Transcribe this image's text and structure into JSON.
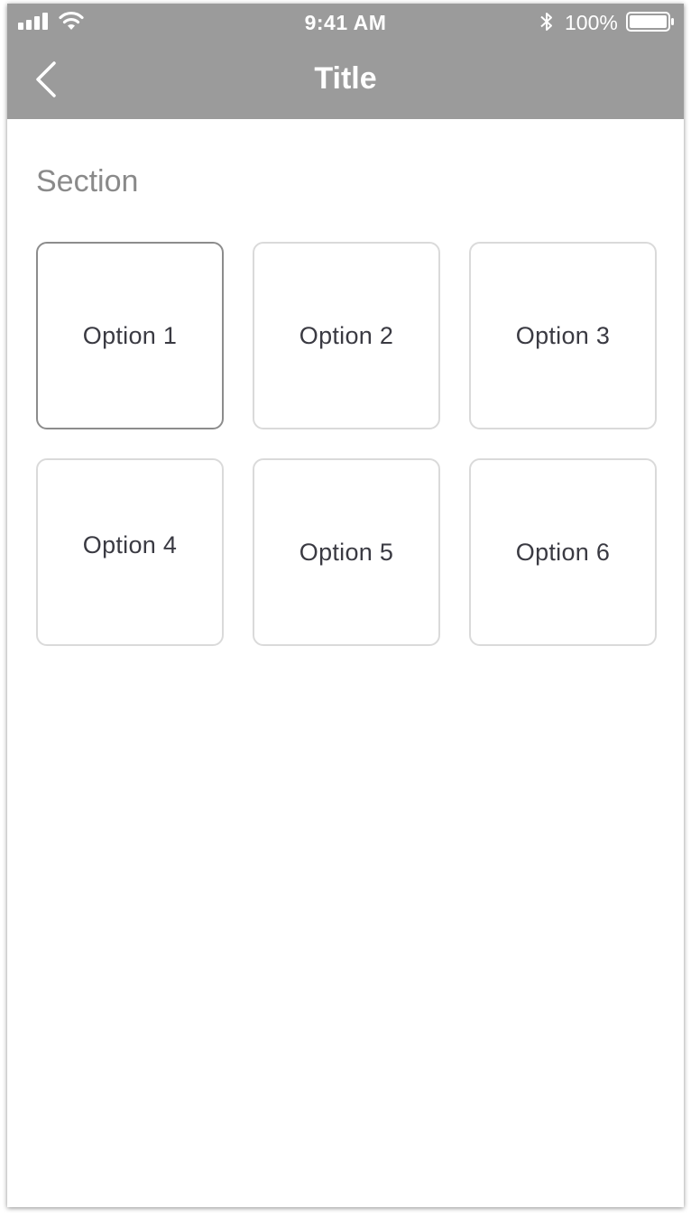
{
  "status_bar": {
    "time": "9:41 AM",
    "battery_percent": "100%",
    "signal_icon": "cellular-signal-icon",
    "wifi_icon": "wifi-icon",
    "bluetooth_icon": "bluetooth-icon",
    "battery_icon": "battery-icon",
    "battery_level": 1.0
  },
  "nav": {
    "title": "Title",
    "back_icon": "chevron-left-icon"
  },
  "colors": {
    "nav_background": "#9b9b9b",
    "selected_border": "#8c8c8c",
    "option_border": "#dadada",
    "section_text": "#8a8a8a"
  },
  "section": {
    "title": "Section"
  },
  "options": [
    {
      "label": "Option 1",
      "selected": true
    },
    {
      "label": "Option 2",
      "selected": false
    },
    {
      "label": "Option 3",
      "selected": false
    },
    {
      "label": "Option 4",
      "selected": false
    },
    {
      "label": "Option 5",
      "selected": false
    },
    {
      "label": "Option 6",
      "selected": false
    }
  ]
}
